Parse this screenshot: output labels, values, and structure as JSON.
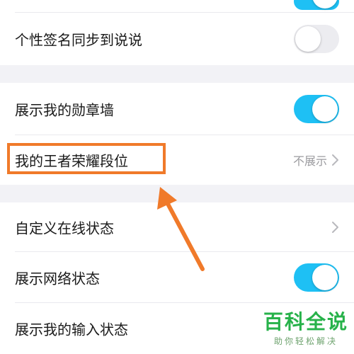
{
  "settings": {
    "group1": {
      "items": [
        {
          "label": "",
          "toggle": "on"
        },
        {
          "label": "个性签名同步到说说",
          "toggle": "off"
        }
      ]
    },
    "group2": {
      "items": [
        {
          "label": "展示我的勋章墙",
          "toggle": "on"
        },
        {
          "label": "我的王者荣耀段位",
          "value": "不展示"
        }
      ]
    },
    "group3": {
      "items": [
        {
          "label": "自定义在线状态"
        },
        {
          "label": "展示网络状态",
          "toggle": "on"
        },
        {
          "label": "展示我的输入状态"
        }
      ]
    }
  },
  "annotation": {
    "highlight_color": "#f07a2a"
  },
  "watermark": {
    "title": "百科全说",
    "subtitle": "助你轻松解决"
  },
  "colors": {
    "toggle_on": "#1ec0f4",
    "toggle_off": "#ececf0",
    "page_bg": "#f2f2f6"
  }
}
